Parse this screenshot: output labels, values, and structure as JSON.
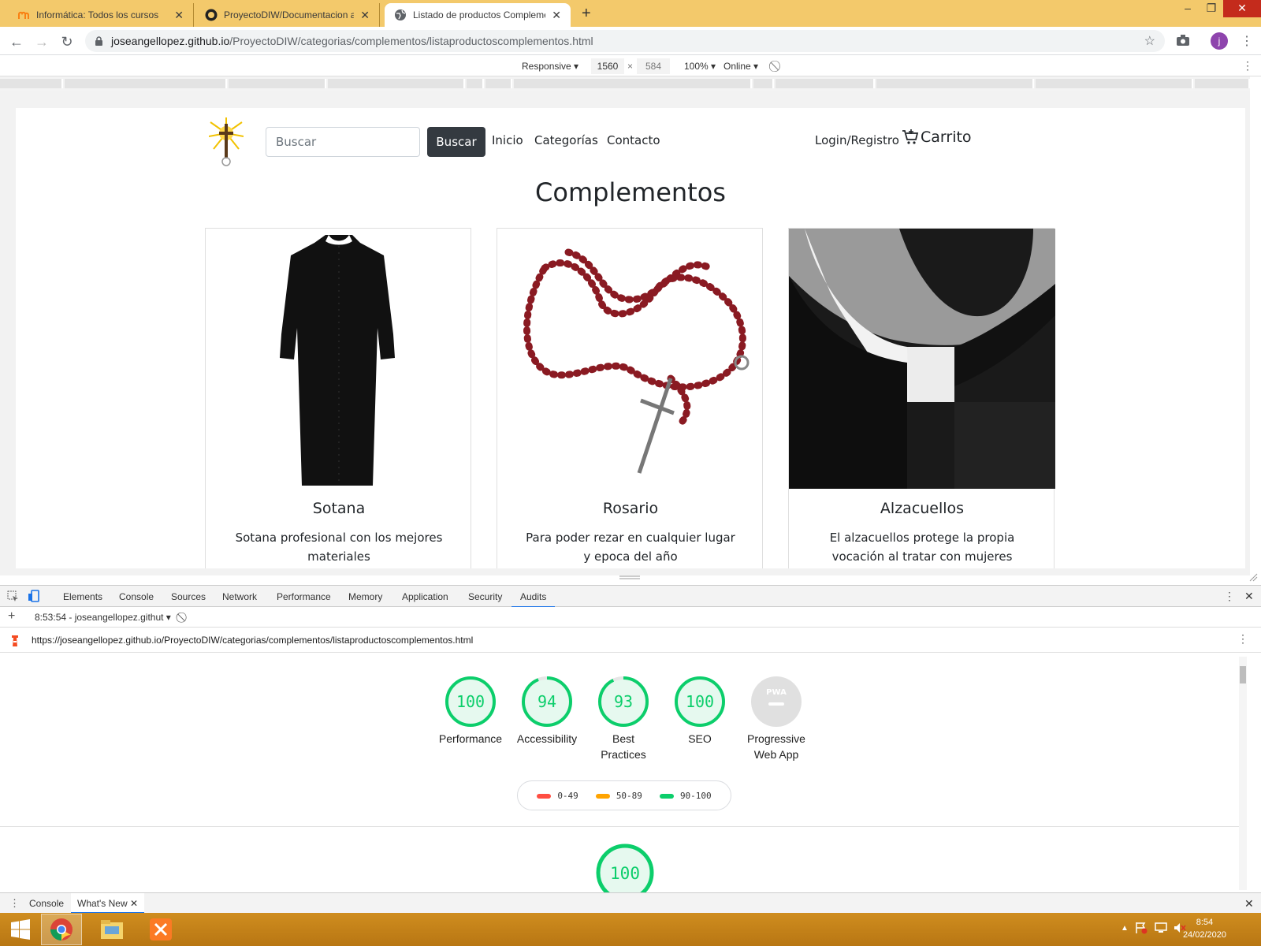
{
  "browser": {
    "tabs": [
      {
        "title": "Informática: Todos los cursos",
        "icon": "moodle-icon"
      },
      {
        "title": "ProyectoDIW/Documentacion at",
        "icon": "github-icon"
      },
      {
        "title": "Listado de productos Compleme",
        "icon": "globe-icon",
        "active": true
      }
    ],
    "url_host": "joseangellopez.github.io",
    "url_path": "/ProyectoDIW/categorias/complementos/listaproductoscomplementos.html",
    "profile_initial": "j"
  },
  "device_toolbar": {
    "mode": "Responsive",
    "width": "1560",
    "x": "×",
    "height": "584",
    "zoom": "100%",
    "network": "Online"
  },
  "site": {
    "search_placeholder": "Buscar",
    "search_button": "Buscar",
    "nav": [
      "Inicio",
      "Categorías",
      "Contacto"
    ],
    "login": "Login/Registro",
    "cart": "Carrito",
    "heading": "Complementos",
    "products": [
      {
        "title": "Sotana",
        "desc": "Sotana profesional con los mejores materiales"
      },
      {
        "title": "Rosario",
        "desc": "Para poder rezar en cualquier lugar y epoca del año"
      },
      {
        "title": "Alzacuellos",
        "desc": "El alzacuellos protege la propia vocación al tratar con mujeres jóvenes y atractivas"
      }
    ]
  },
  "devtools": {
    "tabs": [
      "Elements",
      "Console",
      "Sources",
      "Network",
      "Performance",
      "Memory",
      "Application",
      "Security",
      "Audits"
    ],
    "active_tab": "Audits",
    "report_select": "8:53:54 - joseangellopez.githut",
    "report_url": "https://joseangellopez.github.io/ProyectoDIW/categorias/complementos/listaproductoscomplementos.html",
    "scores": [
      {
        "label": "Performance",
        "value": "100"
      },
      {
        "label": "Accessibility",
        "value": "94"
      },
      {
        "label": "Best Practices",
        "value": "93"
      },
      {
        "label": "SEO",
        "value": "100"
      }
    ],
    "pwa_label": "Progressive Web App",
    "pwa_badge": "PWA",
    "legend": [
      "0-49",
      "50-89",
      "90-100"
    ],
    "legend_colors": [
      "#ff4e42",
      "#ffa400",
      "#0cce6b"
    ],
    "bottom_score": "100",
    "drawer_tabs": [
      "Console",
      "What's New"
    ]
  },
  "taskbar": {
    "time": "8:54",
    "date": "24/02/2020"
  }
}
